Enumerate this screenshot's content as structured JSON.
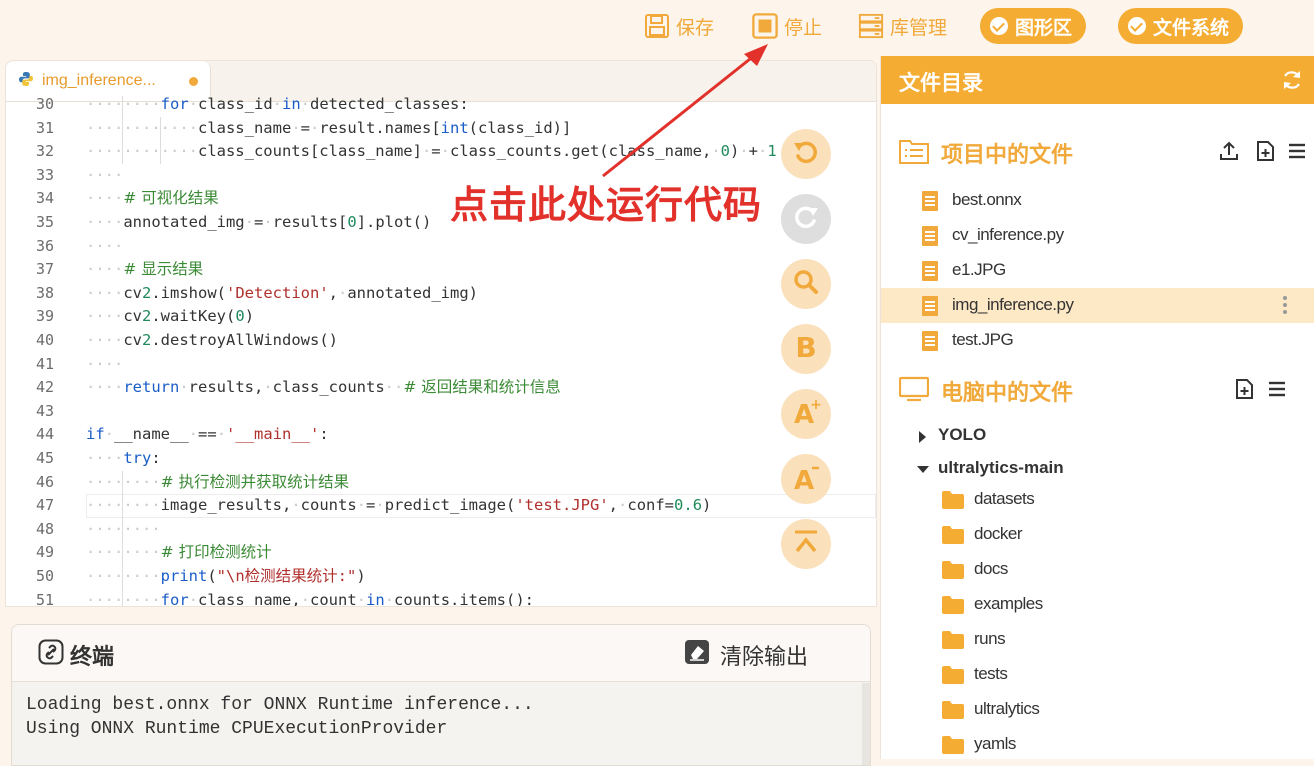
{
  "toolbar": {
    "save_label": "保存",
    "stop_label": "停止",
    "library_label": "库管理",
    "graphics_label": "图形区",
    "filesystem_label": "文件系统"
  },
  "editor": {
    "tab_name": "img_inference...",
    "lines": [
      {
        "n": "30",
        "indent": 2,
        "code": "for class_id in detected_classes:"
      },
      {
        "n": "31",
        "indent": 3,
        "code": "class_name = result.names[int(class_id)]"
      },
      {
        "n": "32",
        "indent": 3,
        "code": "class_counts[class_name] = class_counts.get(class_name, 0) + 1"
      },
      {
        "n": "33",
        "indent": 1,
        "code": ""
      },
      {
        "n": "34",
        "indent": 1,
        "code": "# 可视化结果"
      },
      {
        "n": "35",
        "indent": 1,
        "code": "annotated_img = results[0].plot()"
      },
      {
        "n": "36",
        "indent": 1,
        "code": ""
      },
      {
        "n": "37",
        "indent": 1,
        "code": "# 显示结果"
      },
      {
        "n": "38",
        "indent": 1,
        "code": "cv2.imshow('Detection', annotated_img)"
      },
      {
        "n": "39",
        "indent": 1,
        "code": "cv2.waitKey(0)"
      },
      {
        "n": "40",
        "indent": 1,
        "code": "cv2.destroyAllWindows()"
      },
      {
        "n": "41",
        "indent": 1,
        "code": ""
      },
      {
        "n": "42",
        "indent": 1,
        "code": "return results, class_counts  # 返回结果和统计信息"
      },
      {
        "n": "43",
        "indent": 0,
        "code": ""
      },
      {
        "n": "44",
        "indent": 0,
        "code": "if __name__ == '__main__':"
      },
      {
        "n": "45",
        "indent": 1,
        "code": "try:"
      },
      {
        "n": "46",
        "indent": 2,
        "code": "# 执行检测并获取统计结果"
      },
      {
        "n": "47",
        "indent": 2,
        "code": "image_results, counts = predict_image('test.JPG', conf=0.6)"
      },
      {
        "n": "48",
        "indent": 2,
        "code": ""
      },
      {
        "n": "49",
        "indent": 2,
        "code": "# 打印检测统计"
      },
      {
        "n": "50",
        "indent": 2,
        "code": "print(\"\\n检测结果统计:\")"
      },
      {
        "n": "51",
        "indent": 2,
        "code": "for class_name, count in counts.items():"
      }
    ]
  },
  "annotation": {
    "text": "点击此处运行代码",
    "color": "#e2302a"
  },
  "terminal": {
    "title": "终端",
    "clear_label": "清除输出",
    "lines": [
      "Loading best.onnx for ONNX Runtime inference...",
      "Using ONNX Runtime CPUExecutionProvider"
    ]
  },
  "sidebar": {
    "title": "文件目录",
    "project_section": "项目中的文件",
    "project_files": [
      "best.onnx",
      "cv_inference.py",
      "e1.JPG",
      "img_inference.py",
      "test.JPG"
    ],
    "selected_file": "img_inference.py",
    "computer_section": "电脑中的文件",
    "tree": [
      {
        "name": "YOLO",
        "expanded": false
      },
      {
        "name": "ultralytics-main",
        "expanded": true
      }
    ],
    "folders": [
      "datasets",
      "docker",
      "docs",
      "examples",
      "runs",
      "tests",
      "ultralytics",
      "yamls"
    ]
  },
  "colors": {
    "accent": "#f5ac33",
    "accent_text": "#f0a93a",
    "keyword": "#1a5dc8",
    "string": "#b0302d",
    "comment": "#3b8a35"
  }
}
